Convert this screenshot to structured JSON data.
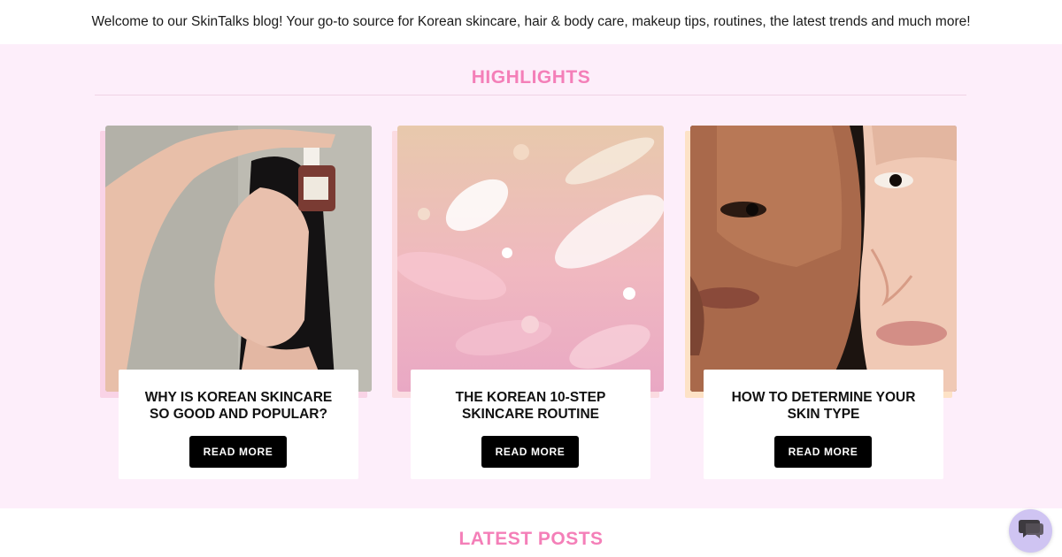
{
  "intro_text": "Welcome to our SkinTalks blog! Your go-to source for Korean skincare, hair & body care, makeup tips, routines, the latest trends and much more!",
  "highlights": {
    "title": "HIGHLIGHTS",
    "cards": [
      {
        "title_line1": "WHY IS KOREAN SKINCARE",
        "title_line2": "SO GOOD AND POPULAR?",
        "button": "READ MORE",
        "image": "woman-with-serum-bottle-photo"
      },
      {
        "title_line1": "THE KOREAN 10-STEP",
        "title_line2": "SKINCARE ROUTINE",
        "button": "READ MORE",
        "image": "skincare-texture-swatches-photo"
      },
      {
        "title_line1": "HOW TO DETERMINE YOUR",
        "title_line2": "SKIN TYPE",
        "button": "READ MORE",
        "image": "two-faces-closeup-photo"
      }
    ]
  },
  "latest_posts": {
    "title": "LATEST POSTS"
  },
  "chat_widget": {
    "icon": "chat-bubbles-icon"
  },
  "colors": {
    "accent_pink": "#f47fb8",
    "section_bg": "#fdeefa",
    "button_bg": "#000000",
    "chat_bg": "#cfc4f2"
  }
}
